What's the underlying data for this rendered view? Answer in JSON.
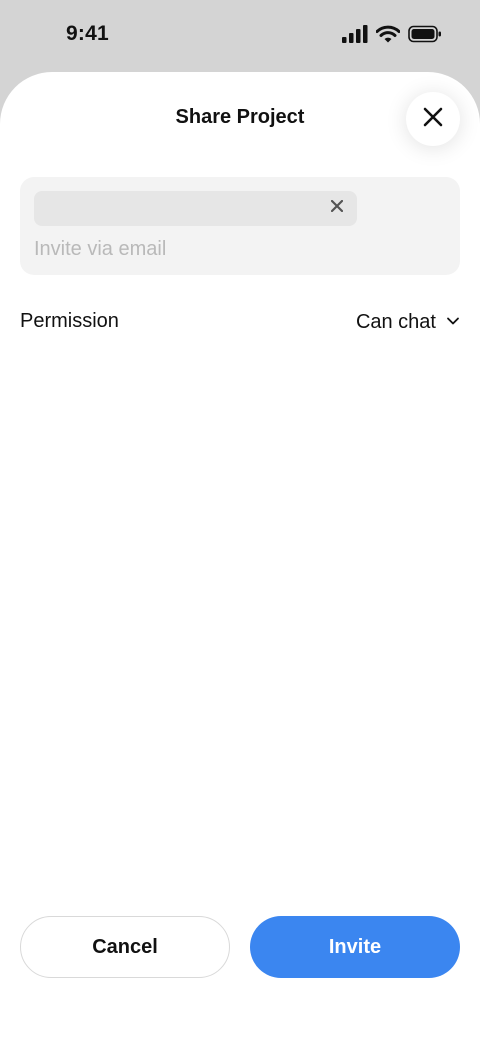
{
  "status_bar": {
    "time": "9:41",
    "icons": [
      "cellular-signal-icon",
      "wifi-icon",
      "battery-icon"
    ]
  },
  "sheet": {
    "title": "Share Project",
    "close_icon": "close-icon"
  },
  "invite": {
    "chip_label": "",
    "chip_clear_icon": "close-icon",
    "email_value": "",
    "email_placeholder": "Invite via email"
  },
  "permission": {
    "label": "Permission",
    "selected": "Can chat",
    "dropdown_icon": "chevron-down-icon"
  },
  "actions": {
    "cancel_label": "Cancel",
    "invite_label": "Invite"
  },
  "colors": {
    "accent": "#3b86f0",
    "backdrop": "#d4d4d4",
    "field_bg": "#f3f3f3",
    "placeholder": "#b9b9b9"
  }
}
